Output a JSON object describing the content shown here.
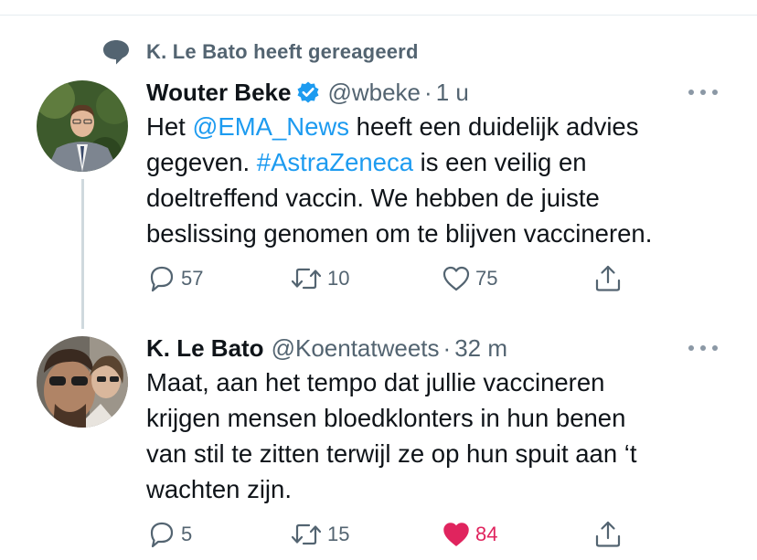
{
  "context": {
    "text": "K. Le Bato heeft gereageerd",
    "icon": "speech-bubble-icon"
  },
  "tweets": [
    {
      "author": "Wouter Beke",
      "verified": true,
      "handle": "@wbeke",
      "separator": "·",
      "time": "1 u",
      "body": {
        "line1_pre": "Het ",
        "mention": "@EMA_News",
        "line1_post": " heeft een duidelijk advies",
        "line2_pre": "gegeven. ",
        "hashtag": "#AstraZeneca",
        "line2_post": " is een veilig en",
        "line3": "doeltreffend vaccin. We hebben de juiste",
        "line4": "beslissing genomen om te blijven vaccineren."
      },
      "actions": {
        "replies": "57",
        "retweets": "10",
        "likes": "75",
        "liked": false
      }
    },
    {
      "author": "K. Le Bato",
      "verified": false,
      "handle": "@Koentatweets",
      "separator": "·",
      "time": "32 m",
      "body": {
        "line1": "Maat, aan het tempo dat jullie vaccineren",
        "line2": "krijgen mensen bloedklonters in hun benen",
        "line3": "van stil te zitten terwijl ze op hun spuit aan ‘t",
        "line4": "wachten zijn."
      },
      "actions": {
        "replies": "5",
        "retweets": "15",
        "likes": "84",
        "liked": true
      }
    }
  ],
  "colors": {
    "link": "#1d9bf0",
    "like_active": "#e0245e",
    "muted": "#536471",
    "verified": "#1d9bf0"
  }
}
